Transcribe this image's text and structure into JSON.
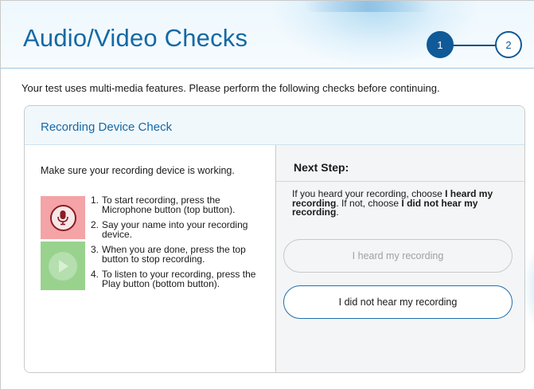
{
  "header": {
    "title": "Audio/Video Checks",
    "steps": [
      {
        "label": "1",
        "state": "active"
      },
      {
        "label": "2",
        "state": "upcoming"
      }
    ]
  },
  "intro_text": "Your test uses multi-media features. Please perform the following checks before continuing.",
  "card": {
    "title": "Recording Device Check",
    "left": {
      "intro": "Make sure your recording device is working.",
      "record_button_icon": "microphone-icon",
      "play_button_icon": "play-icon",
      "instructions": [
        {
          "num": "1.",
          "text": "To start recording, press the Microphone button (top button)."
        },
        {
          "num": "2.",
          "text": "Say your name into your recording device."
        },
        {
          "num": "3.",
          "text": "When you are done, press the top button to stop recording."
        },
        {
          "num": "4.",
          "text": "To listen to your recording, press the Play button (bottom button)."
        }
      ]
    },
    "right": {
      "title": "Next Step:",
      "text_parts": {
        "p1": "If you heard your recording, choose ",
        "b1": "I heard my recording",
        "p2": ". If not, choose ",
        "b2": "I did not hear my recording",
        "p3": "."
      },
      "heard_button": "I heard my recording",
      "not_heard_button": "I did not hear my recording"
    }
  },
  "colors": {
    "brand_blue": "#1569a6",
    "step_active": "#0f5a97",
    "record_bg": "#f4a3a6",
    "play_bg": "#99d28d",
    "mic_border": "#8a1c24"
  }
}
